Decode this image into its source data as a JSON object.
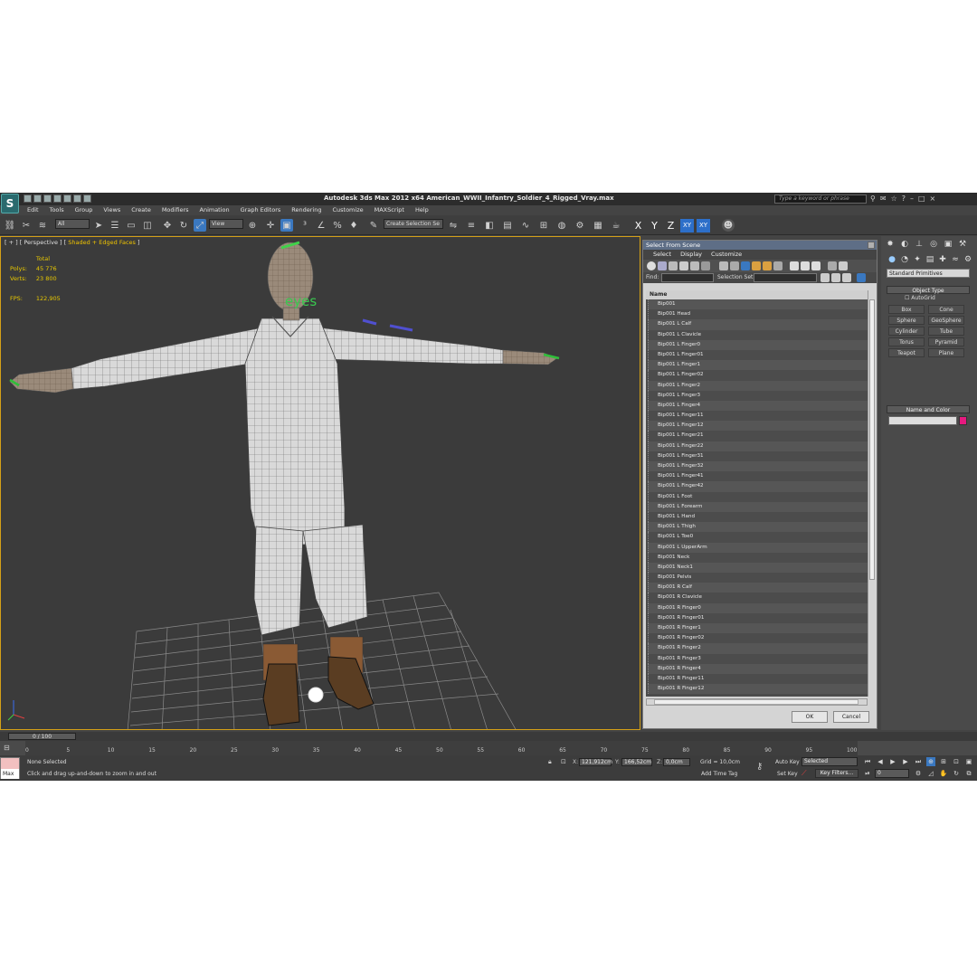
{
  "app": {
    "title": "Autodesk 3ds Max  2012 x64     American_WWII_Infantry_Soldier_4_Rigged_Vray.max",
    "logo_glyph": "S",
    "search_placeholder": "Type a keyword or phrase"
  },
  "menu": [
    "Edit",
    "Tools",
    "Group",
    "Views",
    "Create",
    "Modifiers",
    "Animation",
    "Graph Editors",
    "Rendering",
    "Customize",
    "MAXScript",
    "Help"
  ],
  "toolbar": {
    "filter_value": "All",
    "refcoord_value": "View",
    "selection_set_placeholder": "Create Selection Se",
    "axes": [
      "X",
      "Y",
      "Z",
      "XY",
      "XY"
    ]
  },
  "viewport": {
    "label_prefix": "[ + ] [ Perspective ] [ ",
    "label_mode": "Shaded + Edged Faces",
    "label_suffix": " ]",
    "stats": {
      "header": "Total",
      "polys_label": "Polys:",
      "polys_value": "45 776",
      "verts_label": "Verts:",
      "verts_value": "23 800",
      "fps_label": "FPS:",
      "fps_value": "122,905"
    },
    "helper_text": "eyes"
  },
  "dialog": {
    "title": "Select From Scene",
    "menu": [
      "Select",
      "Display",
      "Customize"
    ],
    "find_label": "Find:",
    "selection_set_label": "Selection Set:",
    "column_header": "Name",
    "items": [
      "Bip001",
      "Bip001 Head",
      "Bip001 L Calf",
      "Bip001 L Clavicle",
      "Bip001 L Finger0",
      "Bip001 L Finger01",
      "Bip001 L Finger1",
      "Bip001 L Finger02",
      "Bip001 L Finger2",
      "Bip001 L Finger3",
      "Bip001 L Finger4",
      "Bip001 L Finger11",
      "Bip001 L Finger12",
      "Bip001 L Finger21",
      "Bip001 L Finger22",
      "Bip001 L Finger31",
      "Bip001 L Finger32",
      "Bip001 L Finger41",
      "Bip001 L Finger42",
      "Bip001 L Foot",
      "Bip001 L Forearm",
      "Bip001 L Hand",
      "Bip001 L Thigh",
      "Bip001 L Toe0",
      "Bip001 L UpperArm",
      "Bip001 Neck",
      "Bip001 Neck1",
      "Bip001 Pelvis",
      "Bip001 R Calf",
      "Bip001 R Clavicle",
      "Bip001 R Finger0",
      "Bip001 R Finger01",
      "Bip001 R Finger1",
      "Bip001 R Finger02",
      "Bip001 R Finger2",
      "Bip001 R Finger3",
      "Bip001 R Finger4",
      "Bip001 R Finger11",
      "Bip001 R Finger12"
    ],
    "ok_label": "OK",
    "cancel_label": "Cancel"
  },
  "command_panel": {
    "dropdown_value": "Standard Primitives",
    "object_type_header": "Object Type",
    "autogrid_label": "AutoGrid",
    "object_buttons": [
      "Box",
      "Cone",
      "Sphere",
      "GeoSphere",
      "Cylinder",
      "Tube",
      "Torus",
      "Pyramid",
      "Teapot",
      "Plane"
    ],
    "name_color_header": "Name and Color",
    "swatch_color": "#e6197f"
  },
  "timeline": {
    "slider_text": "0 / 100",
    "ticks": [
      "0",
      "5",
      "10",
      "15",
      "20",
      "25",
      "30",
      "35",
      "40",
      "45",
      "50",
      "55",
      "60",
      "65",
      "70",
      "75",
      "80",
      "85",
      "90",
      "95",
      "100"
    ]
  },
  "status": {
    "selection": "None Selected",
    "prompt": "Click and drag up-and-down to zoom in and out",
    "maxscript_label": "Max",
    "x_label": "X:",
    "x_value": "121,912cm",
    "y_label": "Y:",
    "y_value": "166,52cm",
    "z_label": "Z:",
    "z_value": "0,0cm",
    "grid": "Grid = 10,0cm",
    "add_time_tag": "Add Time Tag",
    "auto_key": "Auto Key",
    "set_key": "Set Key",
    "selected_value": "Selected",
    "key_filters": "Key Filters...",
    "frame_value": "0"
  }
}
